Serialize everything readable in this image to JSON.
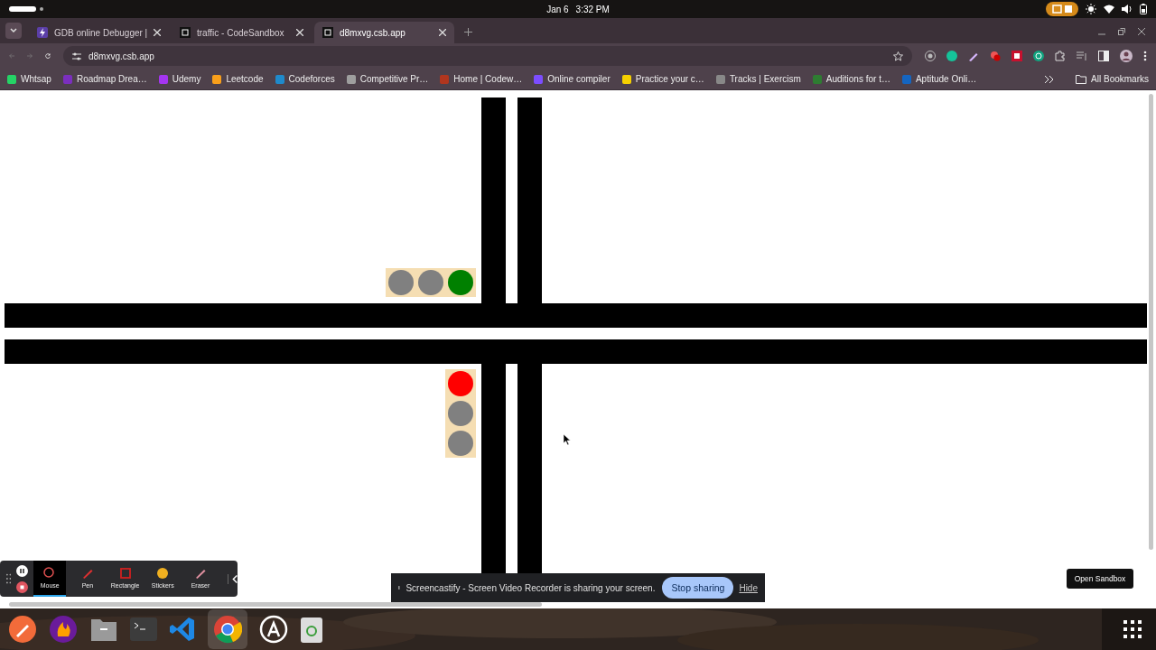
{
  "top_bar": {
    "date": "Jan 6",
    "time": "3:32 PM"
  },
  "tabs": [
    {
      "title": "GDB online Debugger |",
      "selected": false
    },
    {
      "title": "traffic - CodeSandbox",
      "selected": false
    },
    {
      "title": "d8mxvg.csb.app",
      "selected": true
    }
  ],
  "address_bar": {
    "url": "d8mxvg.csb.app"
  },
  "bookmarks": [
    {
      "label": "Whtsap",
      "color": "#25d366"
    },
    {
      "label": "Roadmap Drea…",
      "color": "#7b2fbe"
    },
    {
      "label": "Udemy",
      "color": "#a435f0"
    },
    {
      "label": "Leetcode",
      "color": "#f89f1b"
    },
    {
      "label": "Codeforces",
      "color": "#1f8acb"
    },
    {
      "label": "Competitive Pr…",
      "color": "#9e9e9e"
    },
    {
      "label": "Home | Codew…",
      "color": "#b1361e"
    },
    {
      "label": "Online compiler",
      "color": "#7c4dff"
    },
    {
      "label": "Practice your c…",
      "color": "#f5d000"
    },
    {
      "label": "Tracks | Exercism",
      "color": "#888888"
    },
    {
      "label": "Auditions for t…",
      "color": "#2e7d32"
    },
    {
      "label": "Aptitude Onli…",
      "color": "#1565c0"
    }
  ],
  "all_bookmarks": "All Bookmarks",
  "traffic_lights": [
    {
      "kind": "horizontal",
      "lights": [
        {
          "color": "#808080"
        },
        {
          "color": "#808080"
        },
        {
          "color": "#008000"
        }
      ]
    },
    {
      "kind": "vertical",
      "lights": [
        {
          "color": "#ff0000"
        },
        {
          "color": "#808080"
        },
        {
          "color": "#808080"
        }
      ]
    }
  ],
  "recorder_toolbar": {
    "tools": [
      {
        "label": "Mouse",
        "selected": true
      },
      {
        "label": "Pen",
        "selected": false
      },
      {
        "label": "Rectangle",
        "selected": false
      },
      {
        "label": "Stickers",
        "selected": false
      },
      {
        "label": "Eraser",
        "selected": false
      }
    ]
  },
  "share_banner": {
    "message": "Screencastify - Screen Video Recorder is sharing your screen.",
    "stop_button": "Stop sharing",
    "hide_link": "Hide"
  },
  "open_sandbox": "Open Sandbox"
}
